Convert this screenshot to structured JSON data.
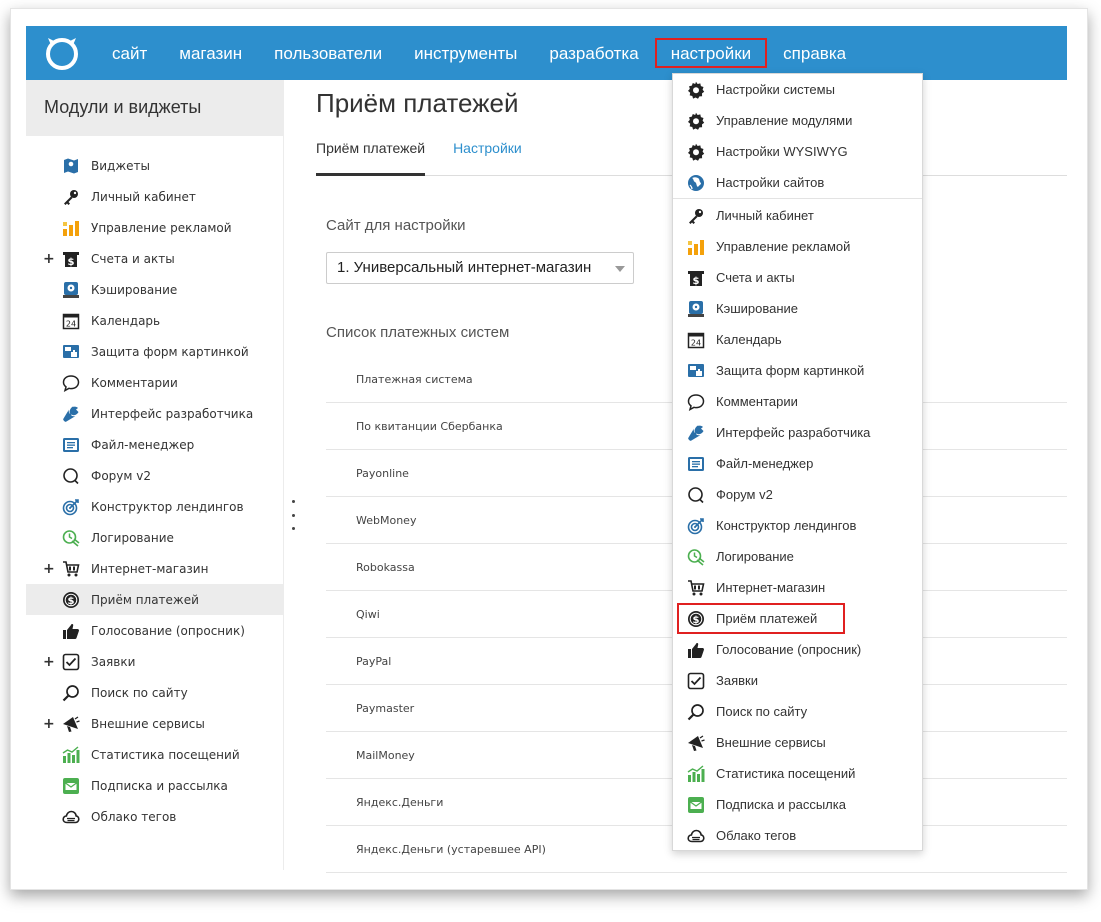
{
  "topbar": {
    "nav": [
      "сайт",
      "магазин",
      "пользователи",
      "инструменты",
      "разработка",
      "настройки",
      "справка"
    ],
    "active_index": 5
  },
  "sidebar": {
    "title": "Модули и виджеты",
    "items": [
      {
        "label": "Виджеты",
        "icon": "map-icon",
        "plus": false
      },
      {
        "label": "Личный кабинет",
        "icon": "key-icon",
        "plus": false
      },
      {
        "label": "Управление рекламой",
        "icon": "ad-chart-icon",
        "plus": false
      },
      {
        "label": "Счета и акты",
        "icon": "invoice-icon",
        "plus": true
      },
      {
        "label": "Кэширование",
        "icon": "cache-icon",
        "plus": false
      },
      {
        "label": "Календарь",
        "icon": "calendar-icon",
        "plus": false
      },
      {
        "label": "Защита форм картинкой",
        "icon": "captcha-icon",
        "plus": false
      },
      {
        "label": "Комментарии",
        "icon": "comment-icon",
        "plus": false
      },
      {
        "label": "Интерфейс разработчика",
        "icon": "wrench-icon",
        "plus": false
      },
      {
        "label": "Файл-менеджер",
        "icon": "file-manager-icon",
        "plus": false
      },
      {
        "label": "Форум v2",
        "icon": "forum-icon",
        "plus": false
      },
      {
        "label": "Конструктор лендингов",
        "icon": "target-icon",
        "plus": false
      },
      {
        "label": "Логирование",
        "icon": "log-icon",
        "plus": false
      },
      {
        "label": "Интернет-магазин",
        "icon": "cart-icon",
        "plus": true
      },
      {
        "label": "Приём платежей",
        "icon": "dollar-coin-icon",
        "plus": false
      },
      {
        "label": "Голосование (опросник)",
        "icon": "thumbs-up-icon",
        "plus": false
      },
      {
        "label": "Заявки",
        "icon": "checkbox-icon",
        "plus": true
      },
      {
        "label": "Поиск по сайту",
        "icon": "search-icon",
        "plus": false
      },
      {
        "label": "Внешние сервисы",
        "icon": "megaphone-icon",
        "plus": true
      },
      {
        "label": "Статистика посещений",
        "icon": "stats-icon",
        "plus": false
      },
      {
        "label": "Подписка и рассылка",
        "icon": "mail-icon",
        "plus": false
      },
      {
        "label": "Облако тегов",
        "icon": "cloud-icon",
        "plus": false
      }
    ],
    "selected_index": 14
  },
  "main": {
    "title": "Приём платежей",
    "tabs": [
      "Приём платежей",
      "Настройки"
    ],
    "site_label": "Сайт для настройки",
    "site_value": "1. Универсальный интернет-магазин",
    "list_label": "Список платежных систем",
    "table_header": "Платежная система",
    "payments": [
      "По квитанции Сбербанка",
      "Payonline",
      "WebMoney",
      "Robokassa",
      "Qiwi",
      "PayPal",
      "Paymaster",
      "MailMoney",
      "Яндекс.Деньги",
      "Яндекс.Деньги (устаревшее API)"
    ]
  },
  "dropdown": {
    "system_items": [
      {
        "label": "Настройки системы",
        "icon": "gear-icon"
      },
      {
        "label": "Управление модулями",
        "icon": "gear-icon"
      },
      {
        "label": "Настройки WYSIWYG",
        "icon": "gear-icon"
      },
      {
        "label": "Настройки сайтов",
        "icon": "globe-icon"
      }
    ],
    "module_items": [
      {
        "label": "Личный кабинет",
        "icon": "key-icon"
      },
      {
        "label": "Управление рекламой",
        "icon": "ad-chart-icon"
      },
      {
        "label": "Счета и акты",
        "icon": "invoice-icon"
      },
      {
        "label": "Кэширование",
        "icon": "cache-icon"
      },
      {
        "label": "Календарь",
        "icon": "calendar-icon"
      },
      {
        "label": "Защита форм картинкой",
        "icon": "captcha-icon"
      },
      {
        "label": "Комментарии",
        "icon": "comment-icon"
      },
      {
        "label": "Интерфейс разработчика",
        "icon": "wrench-icon"
      },
      {
        "label": "Файл-менеджер",
        "icon": "file-manager-icon"
      },
      {
        "label": "Форум v2",
        "icon": "forum-icon"
      },
      {
        "label": "Конструктор лендингов",
        "icon": "target-icon"
      },
      {
        "label": "Логирование",
        "icon": "log-icon"
      },
      {
        "label": "Интернет-магазин",
        "icon": "cart-icon"
      },
      {
        "label": "Приём платежей",
        "icon": "dollar-coin-icon"
      },
      {
        "label": "Голосование (опросник)",
        "icon": "thumbs-up-icon"
      },
      {
        "label": "Заявки",
        "icon": "checkbox-icon"
      },
      {
        "label": "Поиск по сайту",
        "icon": "search-icon"
      },
      {
        "label": "Внешние сервисы",
        "icon": "megaphone-icon"
      },
      {
        "label": "Статистика посещений",
        "icon": "stats-icon"
      },
      {
        "label": "Подписка и рассылка",
        "icon": "mail-icon"
      },
      {
        "label": "Облако тегов",
        "icon": "cloud-icon"
      }
    ],
    "highlight_index": 13
  },
  "colors": {
    "brand": "#2d8fcd",
    "highlight": "#e02020",
    "selected_bg": "#ececec"
  }
}
